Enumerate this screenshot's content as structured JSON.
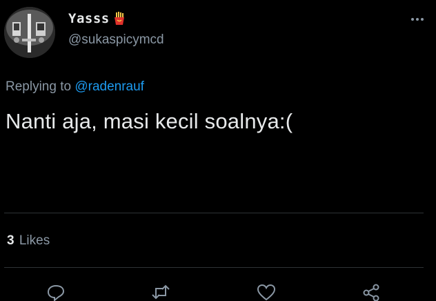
{
  "user": {
    "display_name": "Yasss",
    "name_emoji_icon": "fries-emoji-icon",
    "handle": "@sukaspicymcd",
    "avatar_icon": "profile-photo"
  },
  "reply": {
    "prefix": "Replying to",
    "mention": "@radenrauf"
  },
  "tweet": {
    "text": "Nanti aja, masi kecil soalnya:("
  },
  "stats": {
    "likes_count": "3",
    "likes_label": "Likes"
  },
  "actions": {
    "icons": [
      "reply-icon",
      "retweet-icon",
      "like-icon",
      "share-icon"
    ]
  },
  "colors": {
    "background": "#000000",
    "text_primary": "#e7e9ea",
    "text_secondary": "#8b98a5",
    "accent": "#1d9bf0",
    "divider": "#2f3336"
  }
}
